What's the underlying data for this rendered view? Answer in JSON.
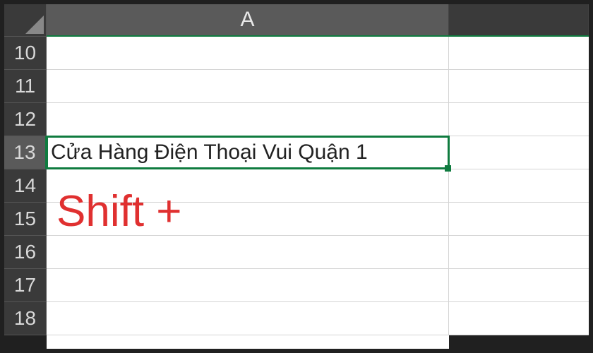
{
  "columns": {
    "a": "A"
  },
  "rows": {
    "r10": "10",
    "r11": "11",
    "r12": "12",
    "r13": "13",
    "r14": "14",
    "r15": "15",
    "r16": "16",
    "r17": "17",
    "r18": "18"
  },
  "cells": {
    "a13": "Cửa Hàng Điện Thoại Vui Quận 1"
  },
  "selection": {
    "active_cell": "A13",
    "active_row": "13",
    "active_col": "A"
  },
  "annotation": {
    "text": "Shift +"
  }
}
